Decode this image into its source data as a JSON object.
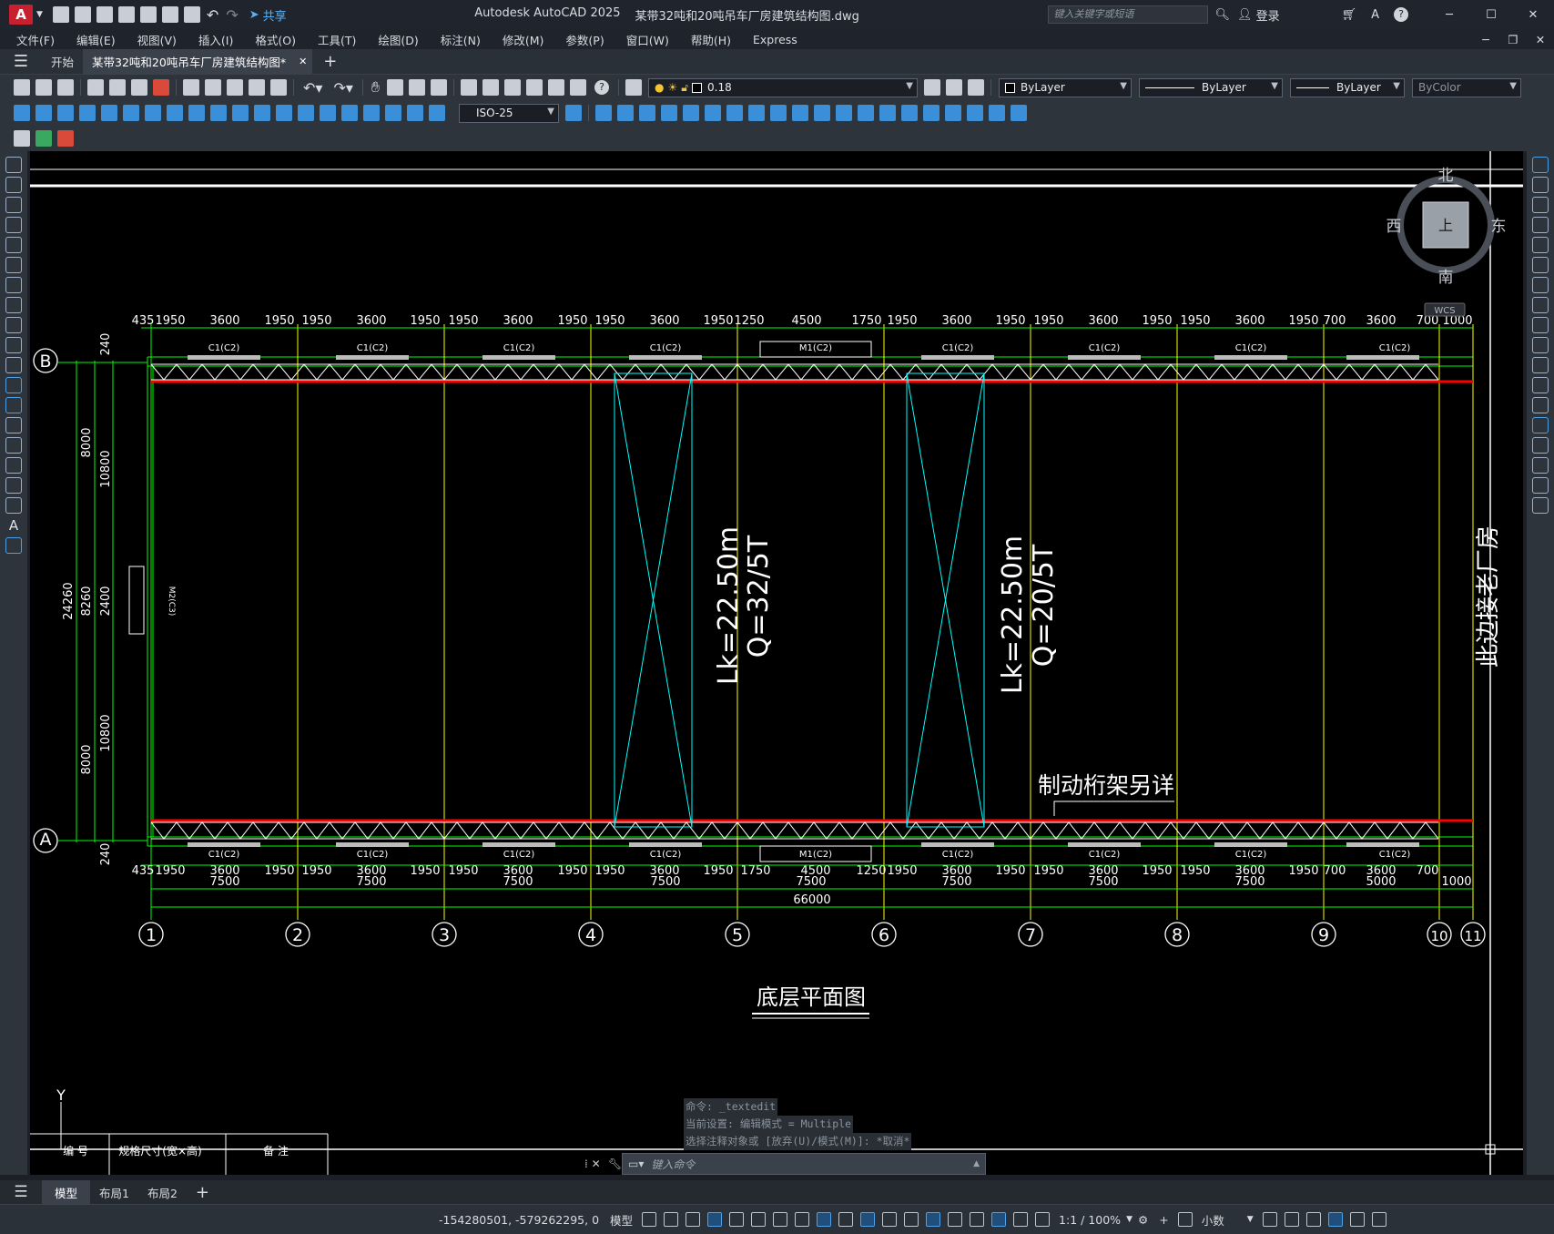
{
  "app": {
    "title": "Autodesk AutoCAD 2025",
    "filename": "某带32吨和20吨吊车厂房建筑结构图.dwg",
    "share_label": "共享",
    "search_placeholder": "键入关键字或短语",
    "login_label": "登录"
  },
  "menu": [
    "文件(F)",
    "编辑(E)",
    "视图(V)",
    "插入(I)",
    "格式(O)",
    "工具(T)",
    "绘图(D)",
    "标注(N)",
    "修改(M)",
    "参数(P)",
    "窗口(W)",
    "帮助(H)",
    "Express"
  ],
  "tabs": {
    "start_label": "开始",
    "doc_label": "某带32吨和20吨吊车厂房建筑结构图*"
  },
  "toolbar": {
    "layer_value": "0.18",
    "color_value": "ByLayer",
    "linetype_value": "ByLayer",
    "lineweight_value": "ByLayer",
    "plotstyle_value": "ByColor",
    "dimstyle_value": "ISO-25"
  },
  "drawing": {
    "title": "底层平面图",
    "axis_rows": [
      "B",
      "A"
    ],
    "axis_columns": [
      "1",
      "2",
      "3",
      "4",
      "5",
      "6",
      "7",
      "8",
      "9",
      "10",
      "11"
    ],
    "crane1_span": "Lk=22.50m",
    "crane1_capacity": "Q=32/5T",
    "crane2_span": "Lk=22.50m",
    "crane2_capacity": "Q=20/5T",
    "brake_note": "制动桁架另详",
    "side_note": "此边接老厂房",
    "door_left": "M2(C3)",
    "top_dims": [
      "435",
      "1950",
      "3600",
      "1950",
      "1950",
      "3600",
      "1950",
      "1950",
      "3600",
      "1950",
      "1950",
      "3600",
      "1950",
      "1250",
      "4500",
      "1750",
      "1950",
      "3600",
      "1950",
      "1950",
      "3600",
      "1950",
      "1950",
      "3600",
      "1950",
      "700",
      "3600",
      "700",
      "1000"
    ],
    "top_labels": [
      "C1(C2)",
      "C1(C2)",
      "C1(C2)",
      "C1(C2)",
      "M1(C2)",
      "C1(C2)",
      "C1(C2)",
      "C1(C2)",
      "C1(C2)"
    ],
    "bottom_labels": [
      "C1(C2)",
      "C1(C2)",
      "C1(C2)",
      "C1(C2)",
      "M1(C2)",
      "C1(C2)",
      "C1(C2)",
      "C1(C2)",
      "C1(C2)"
    ],
    "bottom_dims_row1": [
      "435",
      "1950",
      "3600",
      "1950",
      "1950",
      "3600",
      "1950",
      "1950",
      "3600",
      "1950",
      "1950",
      "3600",
      "1950",
      "1750",
      "4500",
      "1250",
      "1950",
      "3600",
      "1950",
      "1950",
      "3600",
      "1950",
      "1950",
      "3600",
      "1950",
      "700",
      "3600",
      "700"
    ],
    "bottom_dims_row2": [
      "7500",
      "7500",
      "7500",
      "7500",
      "7500",
      "7500",
      "7500",
      "7500",
      "5000",
      "1000"
    ],
    "total_dim": "66000",
    "left_dims_outer": "24260",
    "left_dims_mid": [
      "8000",
      "8260",
      "8000"
    ],
    "left_dims_inner": [
      "240",
      "10800",
      "2400",
      "10800",
      "240"
    ],
    "table_header": [
      "编  号",
      "规格尺寸(宽×高)",
      "备  注"
    ],
    "ucs_y": "Y",
    "viewcube": {
      "n": "北",
      "s": "南",
      "w": "西",
      "e": "东",
      "face": "上",
      "wcs": "WCS"
    }
  },
  "command": {
    "history": [
      "命令: _textedit",
      "当前设置: 编辑模式 = Multiple",
      "选择注释对象或 [放弃(U)/模式(M)]: *取消*"
    ],
    "placeholder": "键入命令"
  },
  "layouts": [
    "模型",
    "布局1",
    "布局2"
  ],
  "status": {
    "coords": "-154280501, -579262295, 0",
    "model_label": "模型",
    "scale": "1:1 / 100%",
    "units": "小数"
  }
}
